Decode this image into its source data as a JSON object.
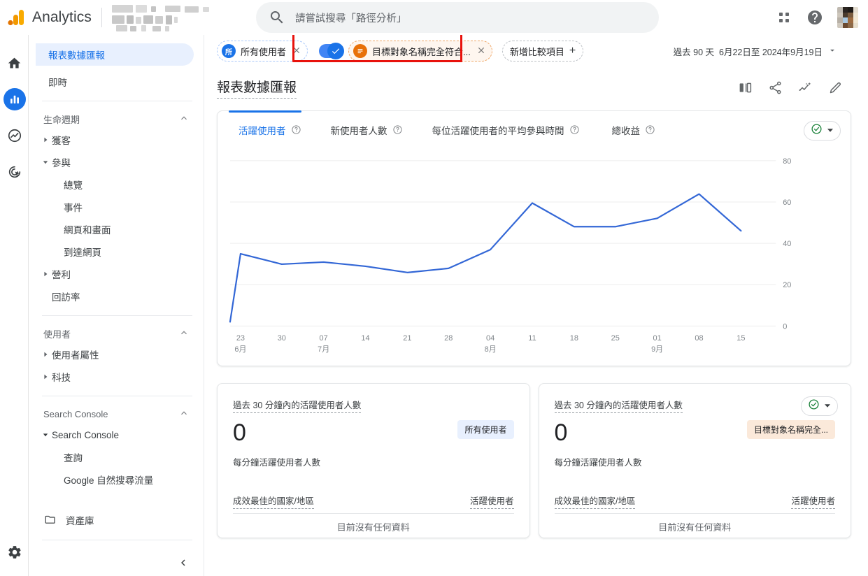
{
  "app": {
    "brand": "Analytics",
    "logo_icon": "analytics-bars-logo",
    "property_name_redacted": true
  },
  "search": {
    "placeholder": "請嘗試搜尋「路徑分析」",
    "icon": "search-icon"
  },
  "topbar_icons": {
    "apps": "apps-grid-icon",
    "help": "help-circle-icon",
    "avatar": "user-avatar"
  },
  "rail": {
    "items": [
      {
        "name": "home",
        "icon": "home-icon",
        "active": false
      },
      {
        "name": "reports",
        "icon": "bar-chart-icon",
        "active": true
      },
      {
        "name": "explore",
        "icon": "explore-trend-icon",
        "active": false
      },
      {
        "name": "advertising",
        "icon": "advertising-target-icon",
        "active": false
      }
    ],
    "settings": {
      "name": "admin",
      "icon": "gear-icon"
    }
  },
  "sidebar": {
    "top_items": [
      {
        "label": "報表數據匯報",
        "selected": true
      },
      {
        "label": "即時",
        "selected": false
      }
    ],
    "groups": [
      {
        "title": "生命週期",
        "collapse_icon": "chevron-up-icon",
        "rows": [
          {
            "label": "獲客",
            "level": 1,
            "expander": "triangle-right-icon"
          },
          {
            "label": "參與",
            "level": 1,
            "expander": "triangle-down-icon"
          },
          {
            "label": "總覽",
            "level": 2,
            "expander": ""
          },
          {
            "label": "事件",
            "level": 2,
            "expander": ""
          },
          {
            "label": "網頁和畫面",
            "level": 2,
            "expander": ""
          },
          {
            "label": "到達網頁",
            "level": 2,
            "expander": ""
          },
          {
            "label": "營利",
            "level": 1,
            "expander": "triangle-right-icon"
          },
          {
            "label": "回訪率",
            "level": 1,
            "expander": ""
          }
        ]
      },
      {
        "title": "使用者",
        "collapse_icon": "chevron-up-icon",
        "rows": [
          {
            "label": "使用者屬性",
            "level": 1,
            "expander": "triangle-right-icon"
          },
          {
            "label": "科技",
            "level": 1,
            "expander": "triangle-right-icon"
          }
        ]
      },
      {
        "title": "Search Console",
        "collapse_icon": "chevron-up-icon",
        "rows": [
          {
            "label": "Search Console",
            "level": 1,
            "expander": "triangle-down-icon",
            "bold": true
          },
          {
            "label": "查詢",
            "level": 2,
            "expander": ""
          },
          {
            "label": "Google 自然搜尋流量",
            "level": 2,
            "expander": ""
          }
        ]
      }
    ],
    "footer": {
      "label": "資產庫",
      "icon": "folder-icon"
    },
    "collapse": {
      "icon": "chevron-left-icon"
    }
  },
  "comparison_bar": {
    "all_users_chip": {
      "label": "所有使用者",
      "avatar_text": "所",
      "close_icon": "close-icon"
    },
    "toggle": {
      "state": "on",
      "icon": "check-icon"
    },
    "audience_chip": {
      "label": "目標對象名稱完全符合...",
      "icon": "list-icon",
      "close_icon": "close-icon"
    },
    "add_comparison": {
      "label": "新增比較項目",
      "icon": "plus-icon"
    },
    "highlight_color": "#e8120c"
  },
  "date_range": {
    "preset": "過去 90 天",
    "range": "6月22日至 2024年9月19日",
    "dropdown_icon": "chevron-down-icon"
  },
  "page": {
    "title": "報表數據匯報",
    "actions": [
      {
        "name": "compare-view",
        "icon": "compare-split-icon"
      },
      {
        "name": "share",
        "icon": "share-icon"
      },
      {
        "name": "insights",
        "icon": "insights-sparkline-icon"
      },
      {
        "name": "edit",
        "icon": "pencil-icon"
      }
    ]
  },
  "chart_card": {
    "tabs": [
      {
        "label": "活躍使用者",
        "active": true,
        "help_icon": "help-circle-icon"
      },
      {
        "label": "新使用者人數",
        "active": false,
        "help_icon": "help-circle-icon"
      },
      {
        "label": "每位活躍使用者的平均參與時間",
        "active": false,
        "help_icon": "help-circle-icon"
      },
      {
        "label": "總收益",
        "active": false,
        "help_icon": "help-circle-icon"
      }
    ],
    "quality": {
      "icon": "check-circle-green-icon",
      "dropdown_icon": "triangle-down-icon"
    }
  },
  "chart_data": {
    "type": "line",
    "title": "活躍使用者",
    "xlabel": "",
    "ylabel": "",
    "ylim": [
      0,
      80
    ],
    "yticks": [
      0,
      20,
      40,
      60,
      80
    ],
    "grid": true,
    "legend": "none",
    "line_color": "#3367d6",
    "x": [
      "",
      "23",
      "30",
      "07",
      "14",
      "21",
      "28",
      "04",
      "11",
      "18",
      "25",
      "01",
      "08",
      "15"
    ],
    "tick_labels": [
      {
        "day": "23",
        "month": "6月"
      },
      {
        "day": "30",
        "month": ""
      },
      {
        "day": "07",
        "month": "7月"
      },
      {
        "day": "14",
        "month": ""
      },
      {
        "day": "21",
        "month": ""
      },
      {
        "day": "28",
        "month": ""
      },
      {
        "day": "04",
        "month": "8月"
      },
      {
        "day": "11",
        "month": ""
      },
      {
        "day": "18",
        "month": ""
      },
      {
        "day": "25",
        "month": ""
      },
      {
        "day": "01",
        "month": "9月"
      },
      {
        "day": "08",
        "month": ""
      },
      {
        "day": "15",
        "month": ""
      }
    ],
    "series": [
      {
        "name": "活躍使用者",
        "values": [
          2,
          35,
          30,
          31,
          29,
          26,
          28,
          37,
          59.5,
          48,
          48,
          52,
          64,
          46
        ]
      }
    ]
  },
  "realtime_cards": [
    {
      "label": "過去 30 分鐘內的活躍使用者人數",
      "value": "0",
      "sublabel": "每分鐘活躍使用者人數",
      "badge": {
        "text": "所有使用者",
        "style": "blue"
      },
      "quality": null,
      "footer_left": "成效最佳的國家/地區",
      "footer_right": "活躍使用者",
      "empty_text": "目前沒有任何資料"
    },
    {
      "label": "過去 30 分鐘內的活躍使用者人數",
      "value": "0",
      "sublabel": "每分鐘活躍使用者人數",
      "badge": {
        "text": "目標對象名稱完全...",
        "style": "orange"
      },
      "quality": {
        "icon": "check-circle-green-icon",
        "dropdown_icon": "triangle-down-icon"
      },
      "footer_left": "成效最佳的國家/地區",
      "footer_right": "活躍使用者",
      "empty_text": "目前沒有任何資料"
    }
  ]
}
